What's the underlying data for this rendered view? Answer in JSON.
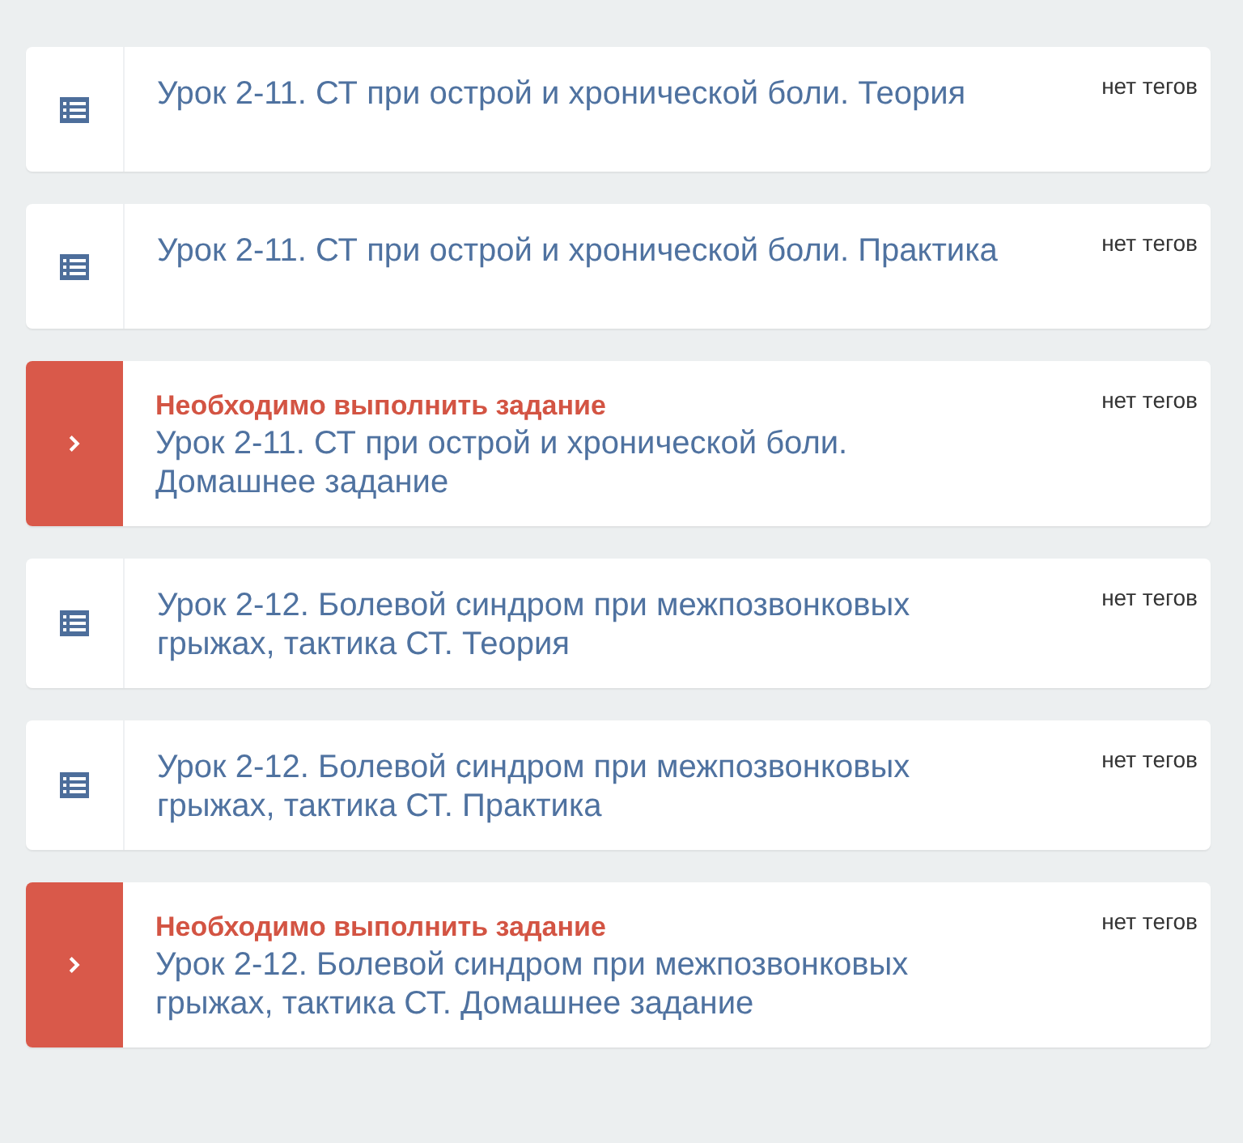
{
  "lessons": [
    {
      "kind": "lesson",
      "title": "Урок 2-11. СТ при острой и хронической боли. Теория",
      "tags": "нет тегов"
    },
    {
      "kind": "lesson",
      "title": "Урок 2-11. СТ при острой и хронической боли. Практика",
      "tags": "нет тегов"
    },
    {
      "kind": "task",
      "notice": "Необходимо выполнить задание",
      "title": "Урок 2-11. СТ при острой и хронической боли. Домашнее задание",
      "tags": "нет тегов"
    },
    {
      "kind": "lesson",
      "title": "Урок 2-12. Болевой синдром при межпозвонковых грыжах, тактика СТ. Теория",
      "tags": "нет тегов"
    },
    {
      "kind": "lesson",
      "title": "Урок 2-12. Болевой синдром при межпозвонковых грыжах, тактика СТ. Практика",
      "tags": "нет тегов"
    },
    {
      "kind": "task",
      "notice": "Необходимо выполнить задание",
      "title": "Урок 2-12. Болевой синдром при межпозвонковых грыжах, тактика СТ. Домашнее задание",
      "tags": "нет тегов"
    }
  ]
}
